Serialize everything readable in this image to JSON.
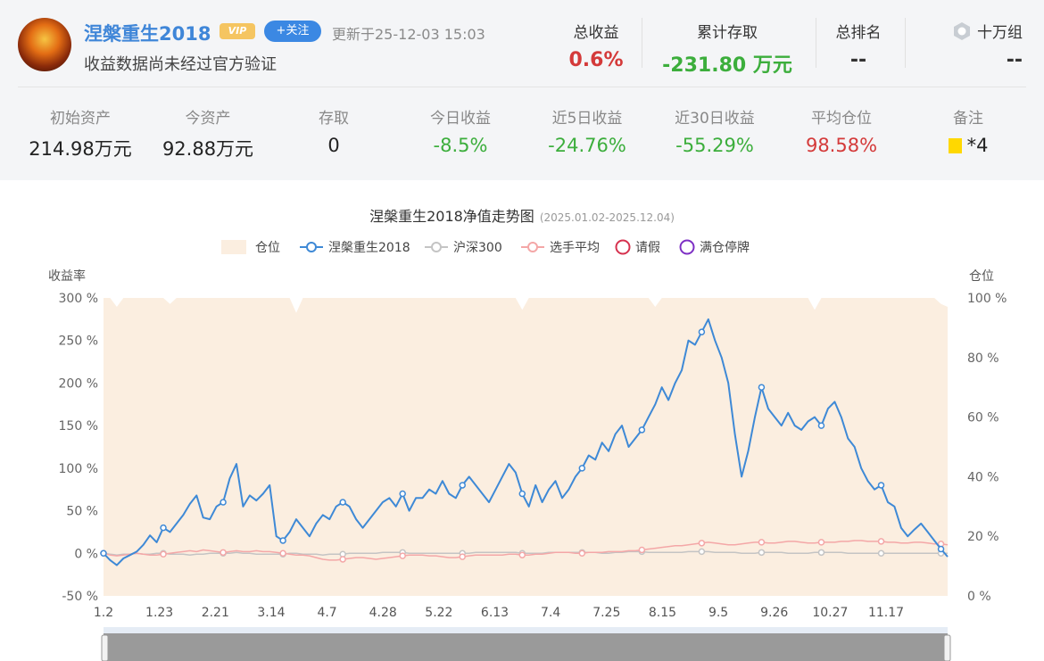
{
  "header": {
    "username": "涅槃重生2018",
    "vip_label": "VIP",
    "follow_label": "+关注",
    "updated": "更新于25-12-03 15:03",
    "verify_note": "收益数据尚未经过官方验证",
    "total_return_label": "总收益",
    "total_return": "0.6%",
    "cum_deposit_label": "累计存取",
    "cum_deposit": "-231.80 万元",
    "total_rank_label": "总排名",
    "total_rank": "--",
    "group_label": "十万组",
    "group_value": "--"
  },
  "stats": [
    {
      "label": "初始资产",
      "value": "214.98万元"
    },
    {
      "label": "今资产",
      "value": "92.88万元"
    },
    {
      "label": "存取",
      "value": "0"
    },
    {
      "label": "今日收益",
      "value": "-8.5%"
    },
    {
      "label": "近5日收益",
      "value": "-24.76%"
    },
    {
      "label": "近30日收益",
      "value": "-55.29%"
    },
    {
      "label": "平均仓位",
      "value": "98.58%"
    },
    {
      "label": "备注",
      "value": "*4"
    }
  ],
  "colors": {
    "accent": "#3b88e3",
    "positive": "#d43a3a",
    "negative": "#3cae3c",
    "position_fill": "#fbeee0",
    "series_main": "#3e89d6",
    "series_index": "#c4c4c4",
    "series_avg": "#f4a7a7"
  },
  "chart_data": {
    "type": "line",
    "title": "涅槃重生2018净值走势图",
    "subtitle": "(2025.01.02-2025.12.04)",
    "ylabel": "收益率",
    "y2label": "仓位",
    "ylim": [
      -50,
      300
    ],
    "y2lim": [
      0,
      100
    ],
    "yticks": [
      "300 %",
      "250 %",
      "200 %",
      "150 %",
      "100 %",
      "50 %",
      "0 %",
      "-50 %"
    ],
    "y2ticks": [
      "100 %",
      "80 %",
      "60 %",
      "40 %",
      "20 %",
      "0 %"
    ],
    "x_labels": [
      "1.2",
      "1.23",
      "2.21",
      "3.14",
      "4.7",
      "4.28",
      "5.22",
      "6.13",
      "7.4",
      "7.25",
      "8.15",
      "9.5",
      "9.26",
      "10.27",
      "11.17"
    ],
    "legend": [
      "仓位",
      "涅槃重生2018",
      "沪深300",
      "选手平均",
      "请假",
      "满仓停牌"
    ],
    "legend_position": "top",
    "series": [
      {
        "name": "涅槃重生2018",
        "values": [
          0,
          -8,
          -14,
          -6,
          -2,
          2,
          10,
          21,
          13,
          30,
          25,
          35,
          45,
          58,
          68,
          42,
          40,
          55,
          60,
          88,
          105,
          55,
          68,
          62,
          70,
          80,
          20,
          15,
          25,
          40,
          30,
          20,
          35,
          45,
          40,
          55,
          60,
          55,
          40,
          30,
          40,
          50,
          60,
          65,
          55,
          70,
          50,
          65,
          65,
          75,
          70,
          85,
          70,
          65,
          80,
          90,
          80,
          70,
          60,
          75,
          90,
          105,
          95,
          70,
          55,
          80,
          60,
          75,
          85,
          65,
          75,
          90,
          100,
          115,
          110,
          130,
          120,
          140,
          150,
          125,
          135,
          145,
          160,
          175,
          195,
          180,
          200,
          215,
          250,
          245,
          260,
          275,
          250,
          230,
          200,
          140,
          90,
          120,
          160,
          195,
          170,
          160,
          150,
          165,
          150,
          145,
          155,
          160,
          150,
          170,
          178,
          160,
          135,
          125,
          100,
          85,
          75,
          80,
          60,
          55,
          30,
          20,
          28,
          35,
          25,
          15,
          5,
          -4
        ]
      },
      {
        "name": "沪深300",
        "values": [
          0,
          -1,
          -2,
          -1,
          -1,
          0,
          -1,
          -1,
          0,
          0,
          -1,
          -1,
          -1,
          -2,
          -1,
          -1,
          0,
          0,
          0,
          0,
          1,
          0,
          0,
          -1,
          -1,
          -1,
          -1,
          -1,
          0,
          0,
          -1,
          -1,
          -1,
          -2,
          -1,
          -1,
          -1,
          0,
          0,
          0,
          0,
          0,
          1,
          1,
          1,
          1,
          0,
          0,
          0,
          0,
          0,
          0,
          0,
          0,
          0,
          0,
          1,
          1,
          1,
          1,
          1,
          1,
          1,
          0,
          0,
          0,
          0,
          1,
          1,
          1,
          1,
          1,
          1,
          1,
          1,
          0,
          0,
          1,
          1,
          2,
          2,
          2,
          1,
          1,
          1,
          1,
          1,
          1,
          2,
          2,
          2,
          2,
          1,
          1,
          1,
          1,
          0,
          0,
          0,
          1,
          1,
          1,
          1,
          0,
          0,
          0,
          0,
          1,
          1,
          1,
          1,
          1,
          0,
          0,
          0,
          0,
          0,
          0,
          0,
          0,
          0,
          0,
          0,
          0,
          0,
          0,
          0,
          0
        ]
      },
      {
        "name": "选手平均",
        "values": [
          0,
          -2,
          -3,
          -2,
          -1,
          0,
          -1,
          -2,
          -2,
          -1,
          0,
          1,
          2,
          3,
          2,
          4,
          3,
          2,
          1,
          2,
          3,
          2,
          2,
          3,
          2,
          2,
          1,
          0,
          -1,
          -2,
          -2,
          -3,
          -5,
          -7,
          -8,
          -8,
          -7,
          -6,
          -5,
          -5,
          -6,
          -7,
          -6,
          -5,
          -4,
          -3,
          -2,
          -2,
          -2,
          -3,
          -3,
          -4,
          -5,
          -5,
          -4,
          -3,
          -2,
          -2,
          -2,
          -2,
          -2,
          -1,
          -1,
          -2,
          -2,
          -1,
          -1,
          0,
          1,
          1,
          1,
          0,
          0,
          1,
          1,
          1,
          2,
          2,
          2,
          3,
          3,
          4,
          5,
          6,
          7,
          8,
          9,
          9,
          10,
          11,
          12,
          13,
          12,
          11,
          10,
          10,
          11,
          12,
          13,
          13,
          12,
          12,
          13,
          14,
          14,
          13,
          12,
          12,
          13,
          13,
          13,
          14,
          14,
          15,
          15,
          14,
          14,
          14,
          13,
          13,
          12,
          12,
          13,
          13,
          12,
          11,
          11,
          10
        ]
      },
      {
        "name": "仓位",
        "values": [
          100,
          100,
          97,
          100,
          100,
          100,
          100,
          100,
          100,
          100,
          98,
          100,
          100,
          100,
          100,
          100,
          100,
          100,
          100,
          100,
          100,
          100,
          100,
          100,
          100,
          100,
          100,
          100,
          100,
          95,
          100,
          100,
          100,
          100,
          100,
          100,
          100,
          100,
          100,
          100,
          100,
          100,
          100,
          100,
          100,
          100,
          100,
          100,
          100,
          100,
          100,
          100,
          100,
          100,
          100,
          100,
          100,
          100,
          100,
          100,
          100,
          100,
          100,
          96,
          100,
          100,
          100,
          100,
          100,
          100,
          100,
          100,
          100,
          100,
          100,
          100,
          100,
          100,
          100,
          100,
          100,
          100,
          100,
          97,
          100,
          100,
          100,
          100,
          100,
          100,
          100,
          100,
          100,
          100,
          100,
          100,
          100,
          100,
          100,
          100,
          100,
          100,
          100,
          100,
          100,
          100,
          100,
          96,
          100,
          100,
          100,
          100,
          100,
          100,
          100,
          100,
          100,
          100,
          100,
          100,
          100,
          100,
          100,
          100,
          100,
          100,
          98,
          97
        ]
      }
    ]
  }
}
